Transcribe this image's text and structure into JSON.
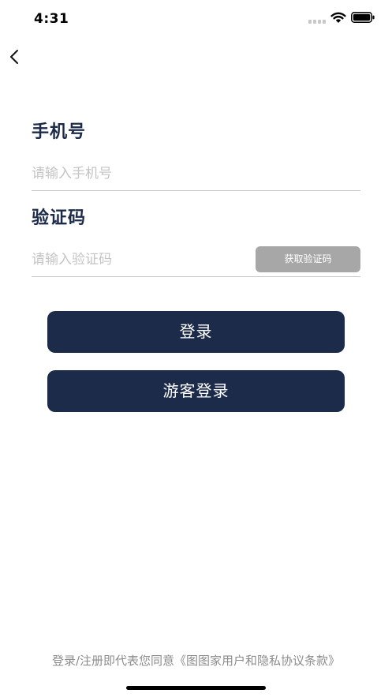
{
  "status_bar": {
    "time": "4:31",
    "icons": [
      "cellular-signal-icon",
      "wifi-icon",
      "battery-icon"
    ]
  },
  "nav": {
    "back_icon": "chevron-left-icon"
  },
  "form": {
    "phone_label": "手机号",
    "phone_placeholder": "请输入手机号",
    "phone_value": "",
    "code_label": "验证码",
    "code_placeholder": "请输入验证码",
    "code_value": "",
    "get_code_label": "获取验证码"
  },
  "buttons": {
    "login_label": "登录",
    "guest_login_label": "游客登录"
  },
  "footer": {
    "agreement_text": "登录/注册即代表您同意《图图家用户和隐私协议条款》"
  },
  "colors": {
    "primary": "#1d2b4a",
    "get_code_button": "#a7a7a7",
    "placeholder": "#c4c4c4",
    "footer_text": "#8c8c8c"
  }
}
